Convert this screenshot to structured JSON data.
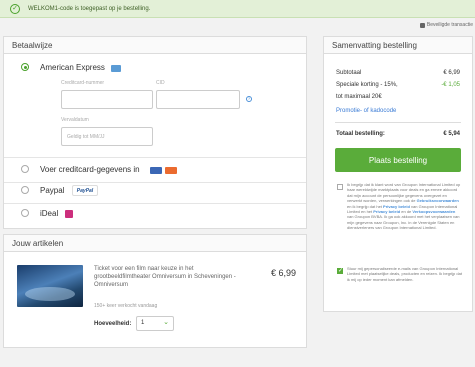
{
  "banner": {
    "message": "WELKOM1-code is toegepast op je bestelling."
  },
  "secure": {
    "label": "Beveiligde transactie"
  },
  "payment": {
    "title": "Betaalwijze",
    "amex_label": "American Express",
    "card_number_label": "Creditcard-nummer",
    "cid_label": "CID",
    "expiry_label": "Vervaldatum",
    "expiry_placeholder": "Geldig tot MM/JJ",
    "options": [
      {
        "label": "Voer creditcard-gegevens in"
      },
      {
        "label": "Paypal"
      },
      {
        "label": "iDeal"
      }
    ],
    "paypal_badge": "PayPal"
  },
  "items": {
    "title": "Jouw artikelen",
    "product_title": "Ticket voor een film naar keuze in het grootbeeldfilmtheater Omniversum in Scheveningen - Omniversum",
    "price": "€ 6,99",
    "sold_note": "150+ keer verkocht vandaag",
    "quantity_label": "Hoeveelheid:",
    "quantity_value": "1"
  },
  "summary": {
    "title": "Samenvatting bestelling",
    "subtotal_label": "Subtotaal",
    "subtotal_value": "€ 6,99",
    "discount_label_1": "Speciale korting - 15%,",
    "discount_label_2": "tot maximaal 20€",
    "discount_value": "-€ 1,05",
    "promo_link": "Promotie- of kadocode",
    "total_label": "Totaal bestelling:",
    "total_value": "€ 5,94",
    "order_button": "Plaats bestelling",
    "terms_text_parts": [
      "Ik begrijp dat ik klant word van Groupon International Limited op haar wereldwijde marktplaats voor deals en ga ermee akkoord dat mijn account de persoonlijke gegevens overgezet en verwerkt worden, verwerkingen ook de ",
      "Gebruiksvoorwaarden",
      " en ik begrijp dat het ",
      "Privacy beleid",
      " van Groupon International Limited en het ",
      "Privacy beleid",
      " en de ",
      "Verkoopsvoorwaarden",
      " van Groupon BVBA. Ik ga ook akkoord met het verplaatsen van mijn gegevens naar Groupon, Inc. in de Verenigde Staten en dienstverleners van Groupon International Limited."
    ],
    "newsletter_text": "Stuur mij gepersonaliseerde e-mails van Groupon International Limited met plaatselijke deals, producten en reizen. Ik begrijp dat ik mij op ieder moment kan afmelden.",
    "accent_color": "#5aac3a"
  }
}
